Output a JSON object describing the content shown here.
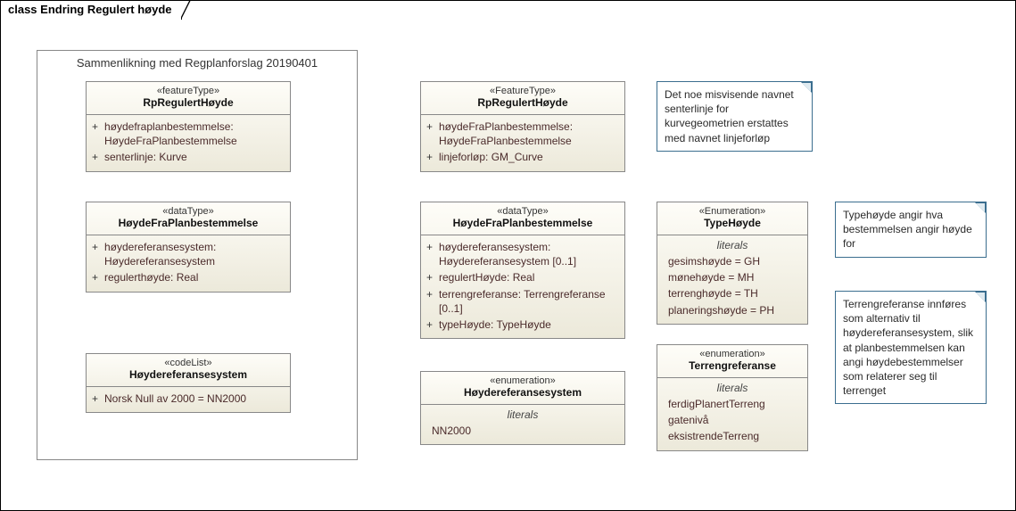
{
  "frame_title": "class Endring Regulert høyde",
  "group": {
    "title": "Sammenlikning med Regplanforslag 20190401"
  },
  "left": {
    "c1": {
      "stereo": "«featureType»",
      "name": "RpRegulertHøyde",
      "attrs": [
        "høydefraplanbestemmelse: HøydeFraPlanbestemmelse",
        "senterlinje: Kurve"
      ]
    },
    "c2": {
      "stereo": "«dataType»",
      "name": "HøydeFraPlanbestemmelse",
      "attrs": [
        "høydereferansesystem: Høydereferansesystem",
        "regulerthøyde: Real"
      ]
    },
    "c3": {
      "stereo": "«codeList»",
      "name": "Høydereferansesystem",
      "attrs": [
        "Norsk Null av 2000 = NN2000"
      ]
    }
  },
  "mid": {
    "c1": {
      "stereo": "«FeatureType»",
      "name": "RpRegulertHøyde",
      "attrs": [
        "høydeFraPlanbestemmelse: HøydeFraPlanbestemmelse",
        "linjeforløp: GM_Curve"
      ]
    },
    "c2": {
      "stereo": "«dataType»",
      "name": "HøydeFraPlanbestemmelse",
      "attrs": [
        "høydereferansesystem: Høydereferansesystem [0..1]",
        "regulertHøyde: Real",
        "terrengreferanse: Terrengreferanse [0..1]",
        "typeHøyde: TypeHøyde"
      ]
    },
    "c3": {
      "stereo": "«enumeration»",
      "name": "Høydereferansesystem",
      "literals_label": "literals",
      "literals": [
        "NN2000"
      ]
    }
  },
  "right": {
    "c1": {
      "stereo": "«Enumeration»",
      "name": "TypeHøyde",
      "literals_label": "literals",
      "literals": [
        "gesimshøyde = GH",
        "mønehøyde = MH",
        "terrenghøyde = TH",
        "planeringshøyde = PH"
      ]
    },
    "c2": {
      "stereo": "«enumeration»",
      "name": "Terrengreferanse",
      "literals_label": "literals",
      "literals": [
        "ferdigPlanertTerreng",
        "gatenivå",
        "eksistrendeTerreng"
      ]
    }
  },
  "notes": {
    "n1": "Det noe misvisende navnet senterlinje for kurvegeometrien erstattes med navnet linjeforløp",
    "n2": "Typehøyde angir hva bestemmelsen angir høyde for",
    "n3": "Terrengreferanse innføres som alternativ til høydereferansesystem, slik at planbestemmelsen kan angi høydebestemmelser som relaterer seg til terrenget"
  }
}
